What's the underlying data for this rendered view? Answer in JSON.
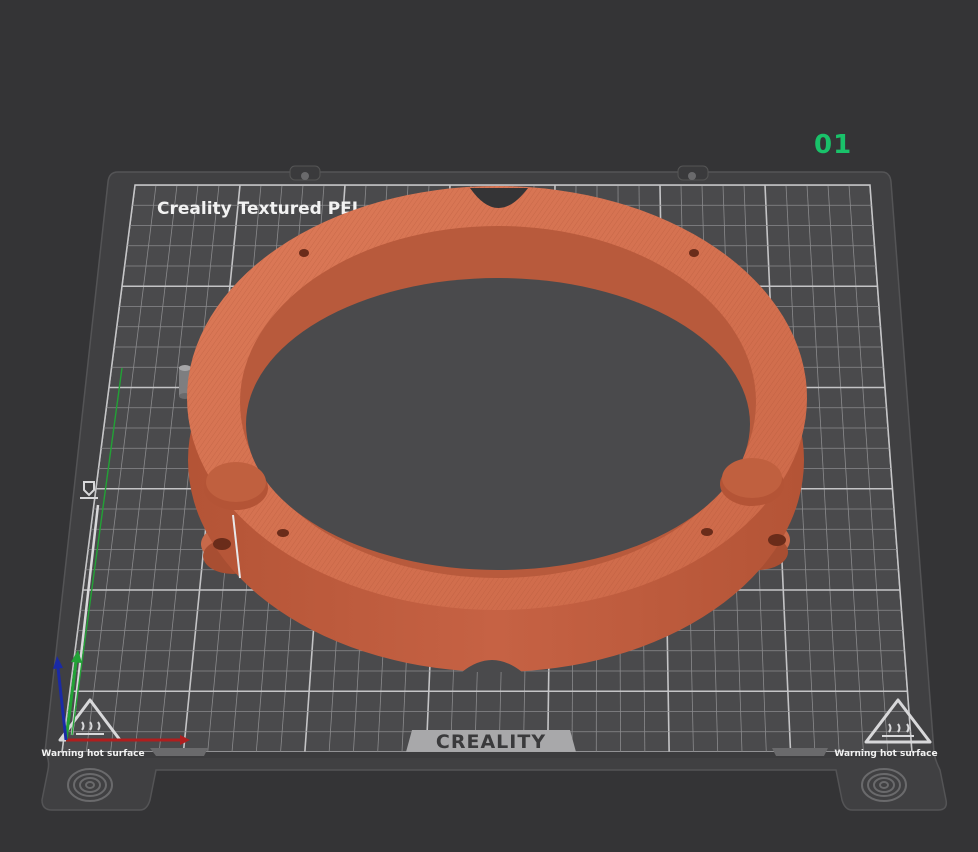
{
  "viewport": {
    "plate_index": "01",
    "bed_label": "Creality Textured PEI",
    "brand_label": "CREALITY",
    "warning_left": "Warning hot surface",
    "warning_right": "Warning hot surface"
  },
  "icons": {
    "heat_warning": "hot-surface-warning-icon",
    "fingerprint": "fingerprint-icon",
    "axis_gizmo": "xyz-axis-icon"
  },
  "colors": {
    "background": "#343436",
    "plate": "#4a4a4c",
    "grid": "#b8b8ba",
    "model": "#d2704e",
    "plate_index": "#19c26a",
    "x_axis": "#b01e1e",
    "y_axis": "#22a236",
    "z_axis": "#1a2aa6"
  }
}
